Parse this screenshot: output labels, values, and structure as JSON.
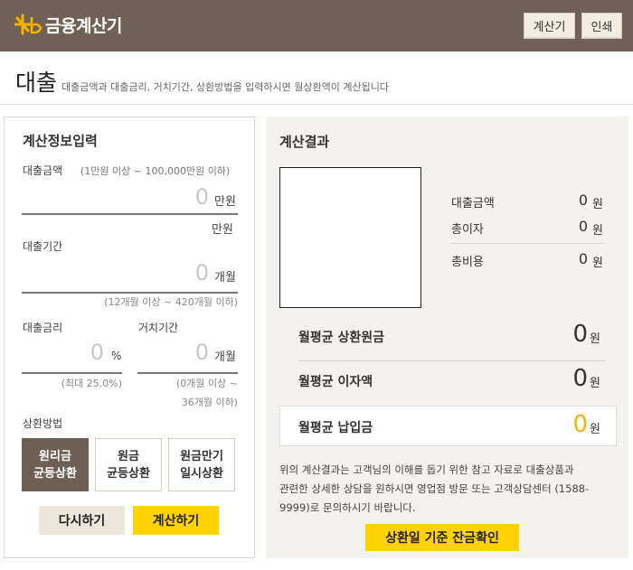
{
  "header": {
    "logo_mark": "kb-star-logo",
    "app_title": "금융계산기",
    "calc_button": "계산기",
    "print_button": "인쇄"
  },
  "page": {
    "title": "대출",
    "description": "대출금액과 대출금리, 거치기간, 상환방법을 입력하시면 월상환액이 계산됩니다"
  },
  "input_panel": {
    "title": "계산정보입력",
    "loan_amount": {
      "label": "대출금액",
      "range": "(1만원 이상 ~ 100,000만원 이하)",
      "value": "0",
      "unit": "만원",
      "converted": "만원"
    },
    "loan_period": {
      "label": "대출기간",
      "value": "0",
      "unit": "개월",
      "hint": "(12개월 이상 ~ 420개월 이하)"
    },
    "interest_rate": {
      "label": "대출금리",
      "value": "0",
      "unit": "%",
      "hint": "(최대 25.0%)"
    },
    "grace_period": {
      "label": "거치기간",
      "value": "0",
      "unit": "개월",
      "hint_line1": "(0개월 이상 ~",
      "hint_line2": "36개월 이하)"
    },
    "repayment": {
      "label": "상환방법",
      "options": [
        {
          "line1": "원리금",
          "line2": "균등상환",
          "selected": true
        },
        {
          "line1": "원금",
          "line2": "균등상환",
          "selected": false
        },
        {
          "line1": "원금만기",
          "line2": "일시상환",
          "selected": false
        }
      ]
    },
    "reset_button": "다시하기",
    "calculate_button": "계산하기"
  },
  "result_panel": {
    "title": "계산결과",
    "summary": [
      {
        "label": "대출금액",
        "value": "0",
        "unit": "원"
      },
      {
        "label": "총이자",
        "value": "0",
        "unit": "원"
      },
      {
        "label": "총비용",
        "value": "0",
        "unit": "원"
      }
    ],
    "monthly": [
      {
        "label": "월평균 상환원금",
        "value": "0",
        "unit": "원"
      },
      {
        "label": "월평균 이자액",
        "value": "0",
        "unit": "원"
      },
      {
        "label": "월평균 납입금",
        "value": "0",
        "unit": "원"
      }
    ],
    "notice_line1": "위의 계산결과는 고객님의 이해를 돕기 위한 참고 자료로 대출상품과",
    "notice_line2": "관련한 상세한 상담을 원하시면 영업점 방문 또는 고객상담센터 (1588-",
    "notice_line3": "9999)로 문의하시기 바랍니다.",
    "balance_button": "상환일 기준 잔금확인"
  },
  "colors": {
    "header_bg": "#706055",
    "accent_yellow": "#ffd200",
    "active_method_bg": "#6e5f55",
    "highlight_value": "#f6b400"
  }
}
